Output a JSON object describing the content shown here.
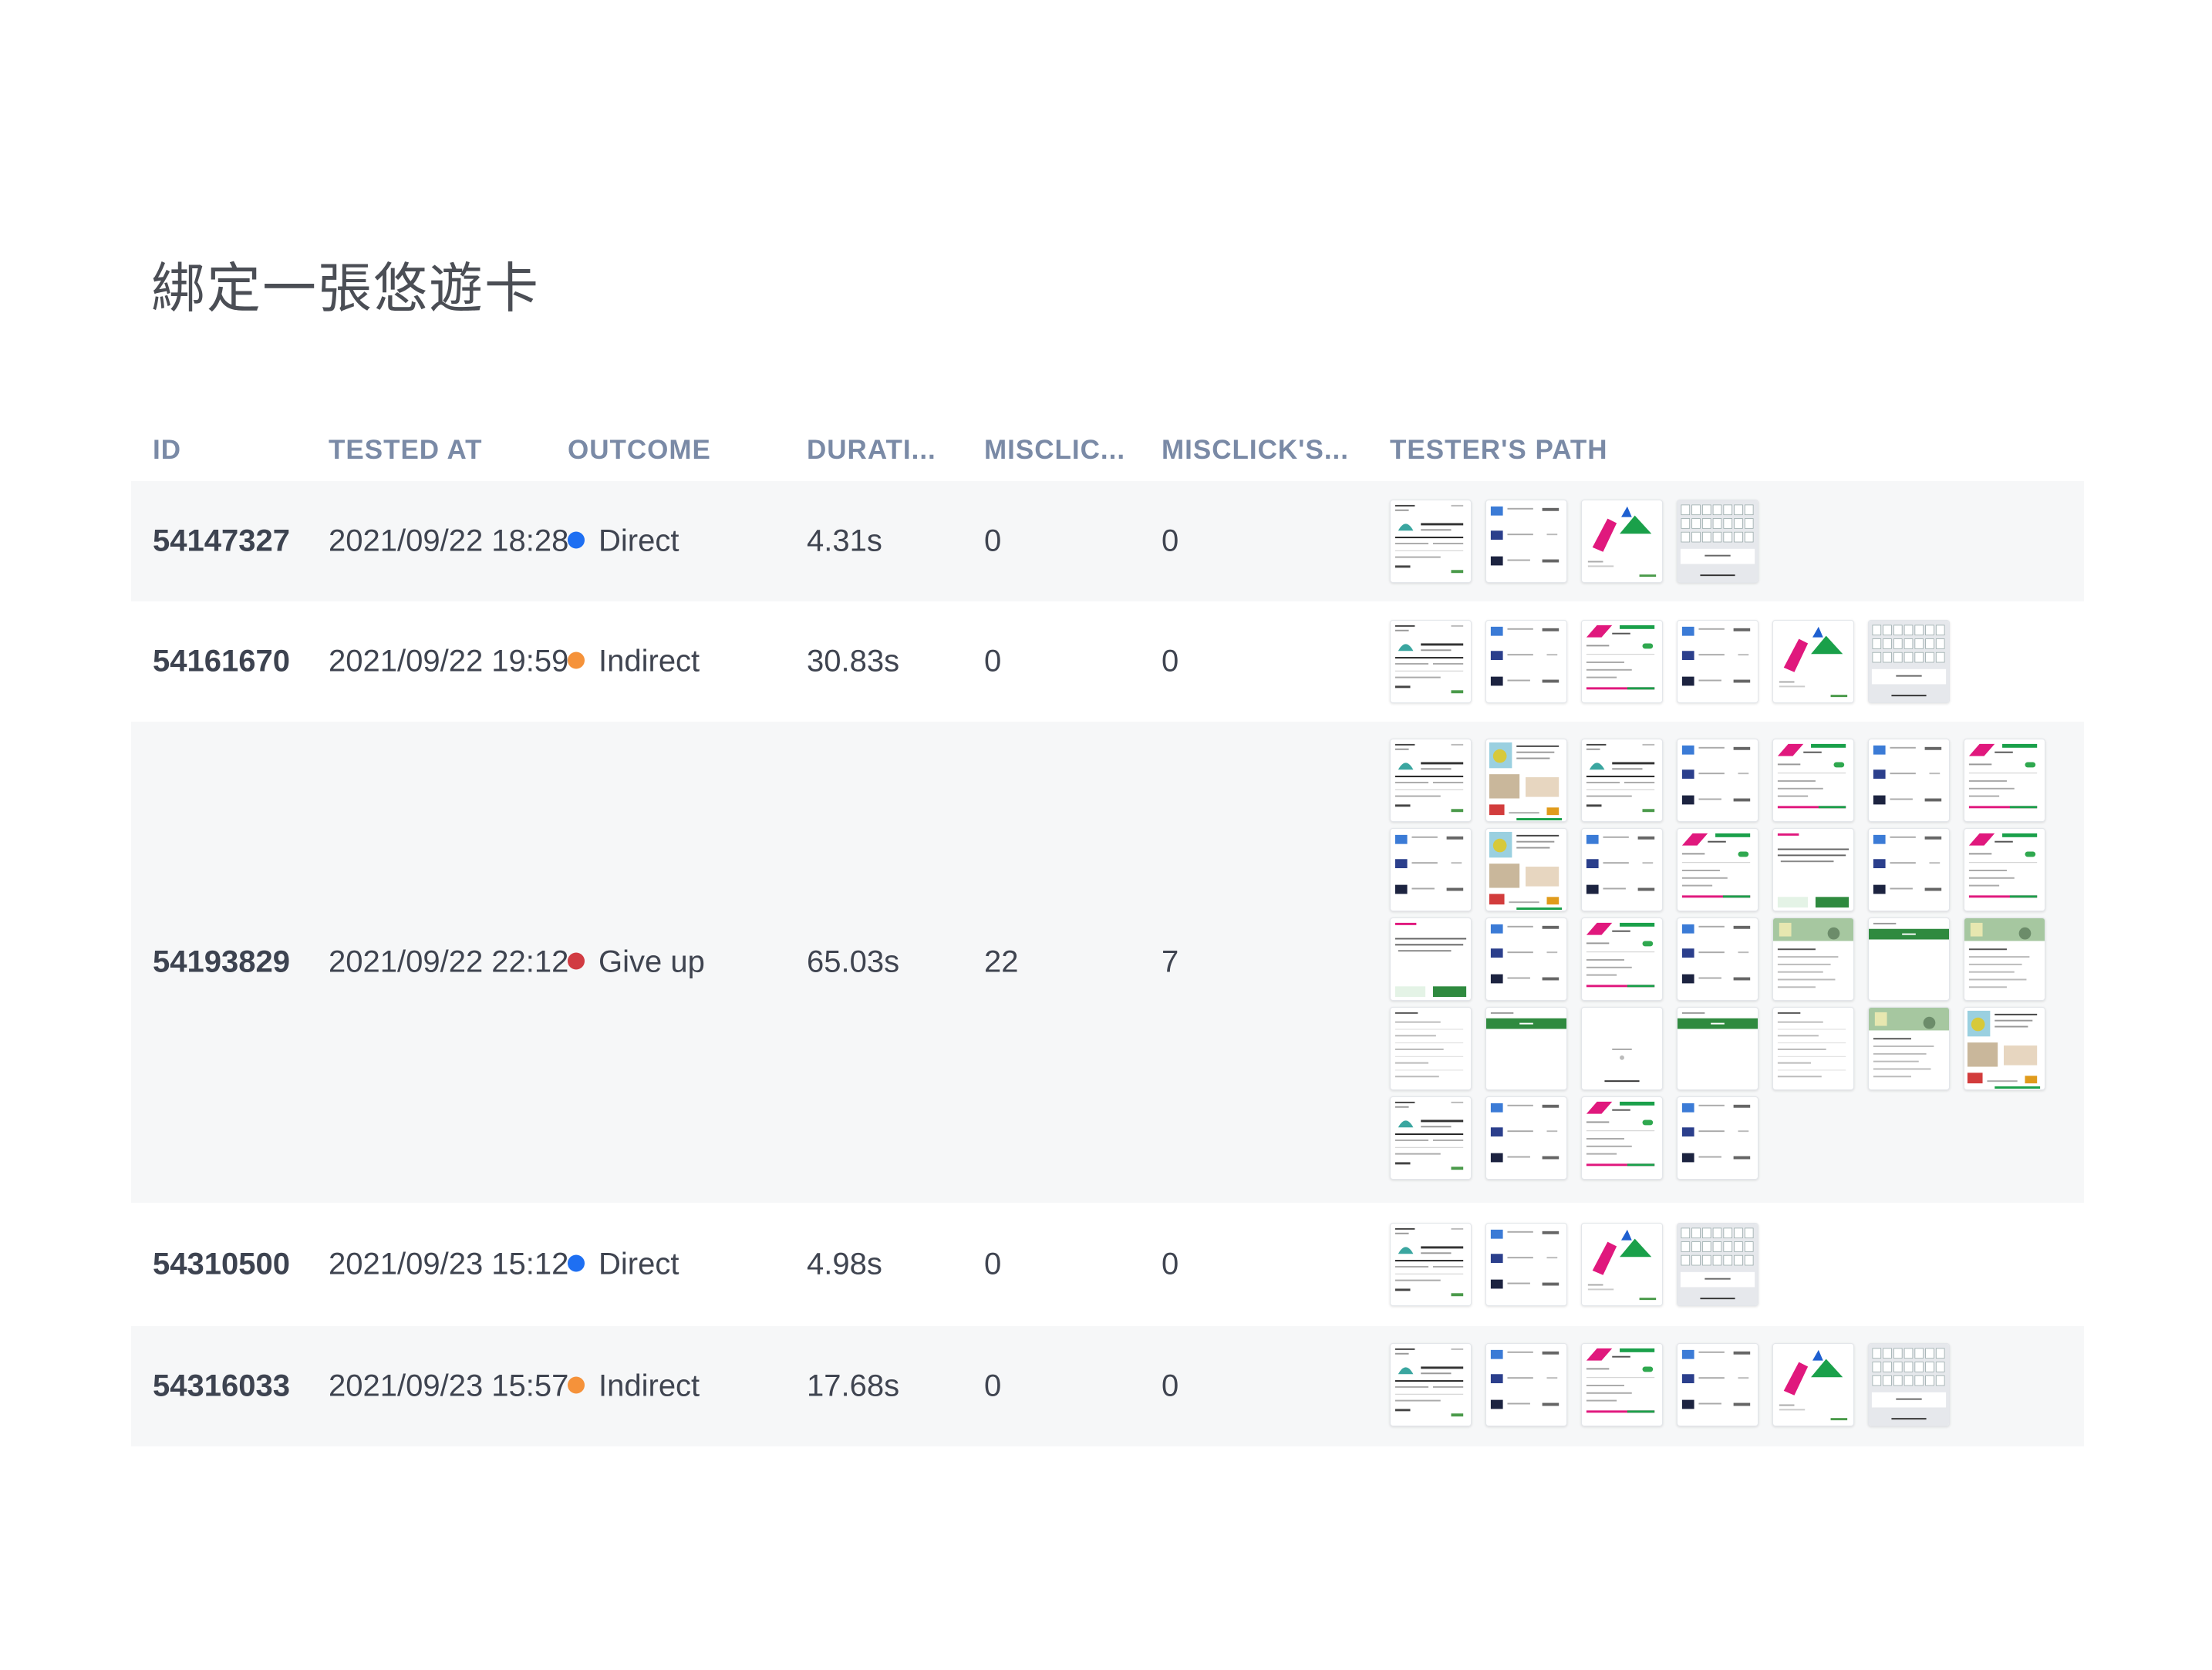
{
  "page": {
    "title": "綁定一張悠遊卡"
  },
  "columns": {
    "id": "ID",
    "tested_at": "TESTED AT",
    "outcome": "OUTCOME",
    "duration": "DURATI...",
    "misclick": "MISCLIC...",
    "misclick_step": "MISCLICK'S...",
    "path": "TESTER'S PATH"
  },
  "colors": {
    "direct": "#1e6ff2",
    "indirect": "#f5923a",
    "giveup": "#d13b42"
  },
  "rows": [
    {
      "id": "54147327",
      "tested_at": "2021/09/22 18:28",
      "outcome": "Direct",
      "outcome_color": "#1e6ff2",
      "duration": "4.31s",
      "misclick": "0",
      "misclick_step": "0",
      "path": [
        "home-screen-icon",
        "card-list-screen-icon",
        "logo-screen-icon",
        "keyboard-screen-icon"
      ]
    },
    {
      "id": "54161670",
      "tested_at": "2021/09/22 19:59",
      "outcome": "Indirect",
      "outcome_color": "#f5923a",
      "duration": "30.83s",
      "misclick": "0",
      "misclick_step": "0",
      "path": [
        "home-screen-icon",
        "card-list-screen-icon",
        "settings-screen-icon",
        "card-list-screen-icon",
        "logo-screen-icon",
        "keyboard-screen-icon"
      ]
    },
    {
      "id": "54193829",
      "tested_at": "2021/09/22 22:12",
      "outcome": "Give up",
      "outcome_color": "#d13b42",
      "duration": "65.03s",
      "misclick": "22",
      "misclick_step": "7",
      "path": [
        "home-screen-icon",
        "promo-screen-icon",
        "home-screen-icon",
        "card-list-screen-icon",
        "settings-screen-icon",
        "card-list-screen-icon",
        "settings-screen-icon",
        "card-list-screen-icon",
        "promo-screen-icon",
        "card-list-screen-icon",
        "settings-screen-icon",
        "dialog-screen-icon",
        "card-list-screen-icon",
        "settings-screen-icon",
        "dialog-screen-icon",
        "card-list-screen-icon",
        "settings-screen-icon",
        "card-list-screen-icon",
        "map-screen-icon",
        "button-screen-icon",
        "map-screen-icon",
        "form-screen-icon",
        "button-screen-icon",
        "loading-screen-icon",
        "button-screen-icon",
        "form-screen-icon",
        "map-screen-icon",
        "promo-screen-icon",
        "home-screen-icon",
        "card-list-screen-icon",
        "settings-screen-icon",
        "card-list-screen-icon"
      ]
    },
    {
      "id": "54310500",
      "tested_at": "2021/09/23 15:12",
      "outcome": "Direct",
      "outcome_color": "#1e6ff2",
      "duration": "4.98s",
      "misclick": "0",
      "misclick_step": "0",
      "path": [
        "home-screen-icon",
        "card-list-screen-icon",
        "logo-screen-icon",
        "keyboard-screen-icon"
      ]
    },
    {
      "id": "54316033",
      "tested_at": "2021/09/23 15:57",
      "outcome": "Indirect",
      "outcome_color": "#f5923a",
      "duration": "17.68s",
      "misclick": "0",
      "misclick_step": "0",
      "path": [
        "home-screen-icon",
        "card-list-screen-icon",
        "settings-screen-icon",
        "card-list-screen-icon",
        "logo-screen-icon",
        "keyboard-screen-icon"
      ]
    }
  ]
}
